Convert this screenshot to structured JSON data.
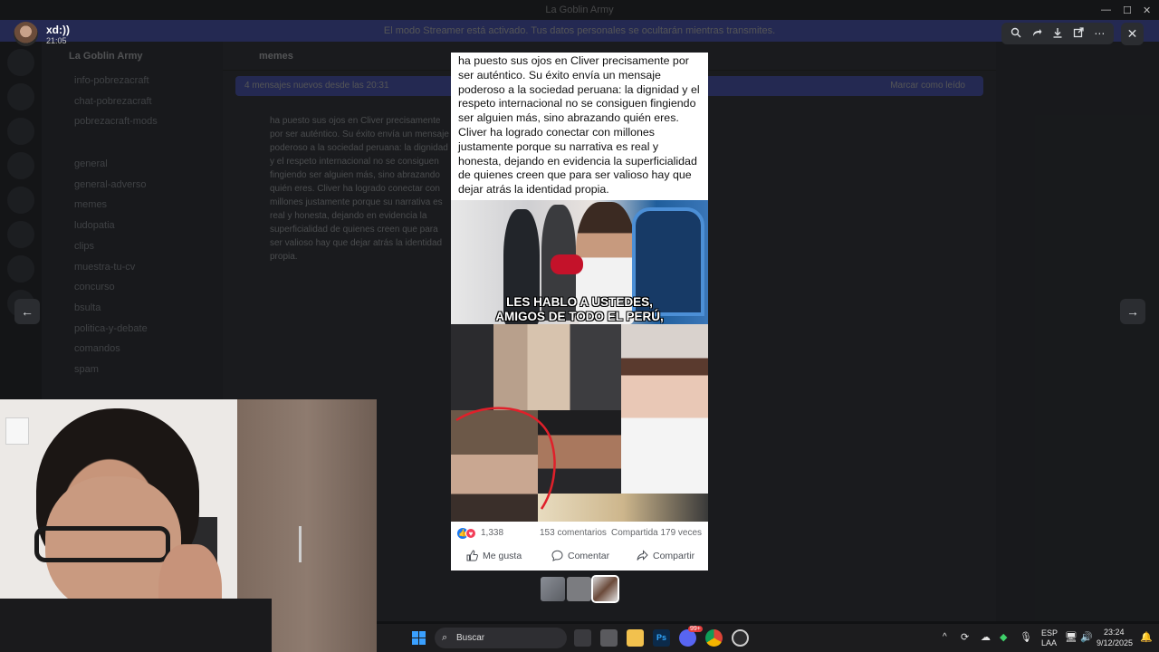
{
  "background": {
    "window_title": "La Goblin Army",
    "banner_text": "El modo Streamer está activado. Tus datos personales se ocultarán mientras transmites.",
    "guild_name": "La Goblin Army",
    "channels": [
      "info-pobrezacraft",
      "chat-pobrezacraft",
      "pobrezacraft-mods",
      "general",
      "general-adverso",
      "memes",
      "ludopatia",
      "clips",
      "muestra-tu-cv",
      "concurso",
      "bsulta",
      "politica-y-debate",
      "comandos",
      "spam"
    ],
    "chat_channel": "memes",
    "new_messages_text": "4 mensajes nuevos desde las 20:31",
    "mark_read_text": "Marcar como leído"
  },
  "viewer": {
    "user_name": "xd:))",
    "timestamp": "21:05",
    "toolbar_icons": [
      "zoom-icon",
      "forward-icon",
      "download-icon",
      "open-external-icon",
      "more-icon"
    ],
    "close_glyph": "✕",
    "prev_glyph": "←",
    "next_glyph": "→"
  },
  "post": {
    "body_text": "ha puesto sus ojos en Cliver precisamente por ser auténtico. Su éxito envía un mensaje poderoso a la sociedad peruana: la dignidad y el respeto internacional no se consiguen fingiendo ser alguien más, sino abrazando quién eres. Cliver ha logrado conectar con millones justamente porque su narrativa es real y honesta, dejando en evidencia la superficialidad de quienes creen que para ser valioso hay que dejar atrás la identidad propia.",
    "photo_caption_line1": "LES HABLO A USTEDES,",
    "photo_caption_line2": "AMIGOS DE TODO EL PERÚ,",
    "reaction_count": "1,338",
    "comments_count": "153 comentarios",
    "shares_count": "Compartida 179 veces",
    "like_label": "Me gusta",
    "comment_label": "Comentar",
    "share_label": "Compartir"
  },
  "taskbar": {
    "search_placeholder": "Buscar",
    "language": "ESP",
    "layout": "LAA",
    "time": "23:24",
    "date": "9/12/2025",
    "discord_badge": "99+"
  },
  "colors": {
    "accent": "#5865f2",
    "facebook_blue": "#1877f2",
    "overlay_bg": "#111214"
  }
}
